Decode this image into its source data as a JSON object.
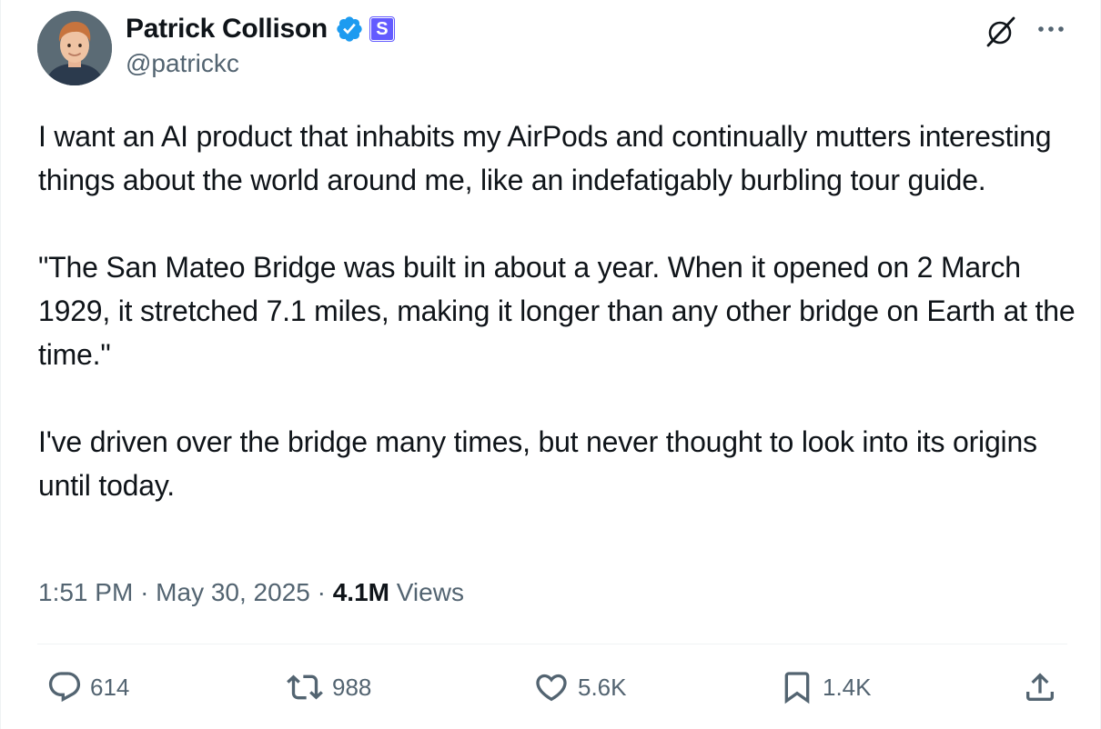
{
  "author": {
    "name": "Patrick Collison",
    "handle": "@patrickc",
    "verified": true,
    "affiliate_badge": "S"
  },
  "icons": {
    "verified": "verified-badge-icon",
    "grok": "grok-icon",
    "more": "more-icon",
    "reply": "reply-icon",
    "repost": "repost-icon",
    "like": "like-icon",
    "bookmark": "bookmark-icon",
    "share": "share-icon"
  },
  "colors": {
    "verified_blue": "#1d9bf0",
    "affiliate_purple": "#635bff",
    "secondary_text": "#536471"
  },
  "tweet": {
    "paragraphs": [
      "I want an AI product that inhabits my AirPods and continually mutters interesting things about the world around me, like an indefatigably burbling tour guide.",
      "\"The San Mateo Bridge was built in about a year. When it opened on 2 March 1929, it stretched 7.1 miles, making it longer than any other bridge on Earth at the time.\"",
      "I've driven over the bridge many times, but never thought to look into its origins until today."
    ],
    "time": "1:51 PM",
    "date": "May 30, 2025",
    "separator": "·",
    "views_count": "4.1M",
    "views_label": "Views"
  },
  "stats": {
    "replies": "614",
    "reposts": "988",
    "likes": "5.6K",
    "bookmarks": "1.4K"
  }
}
